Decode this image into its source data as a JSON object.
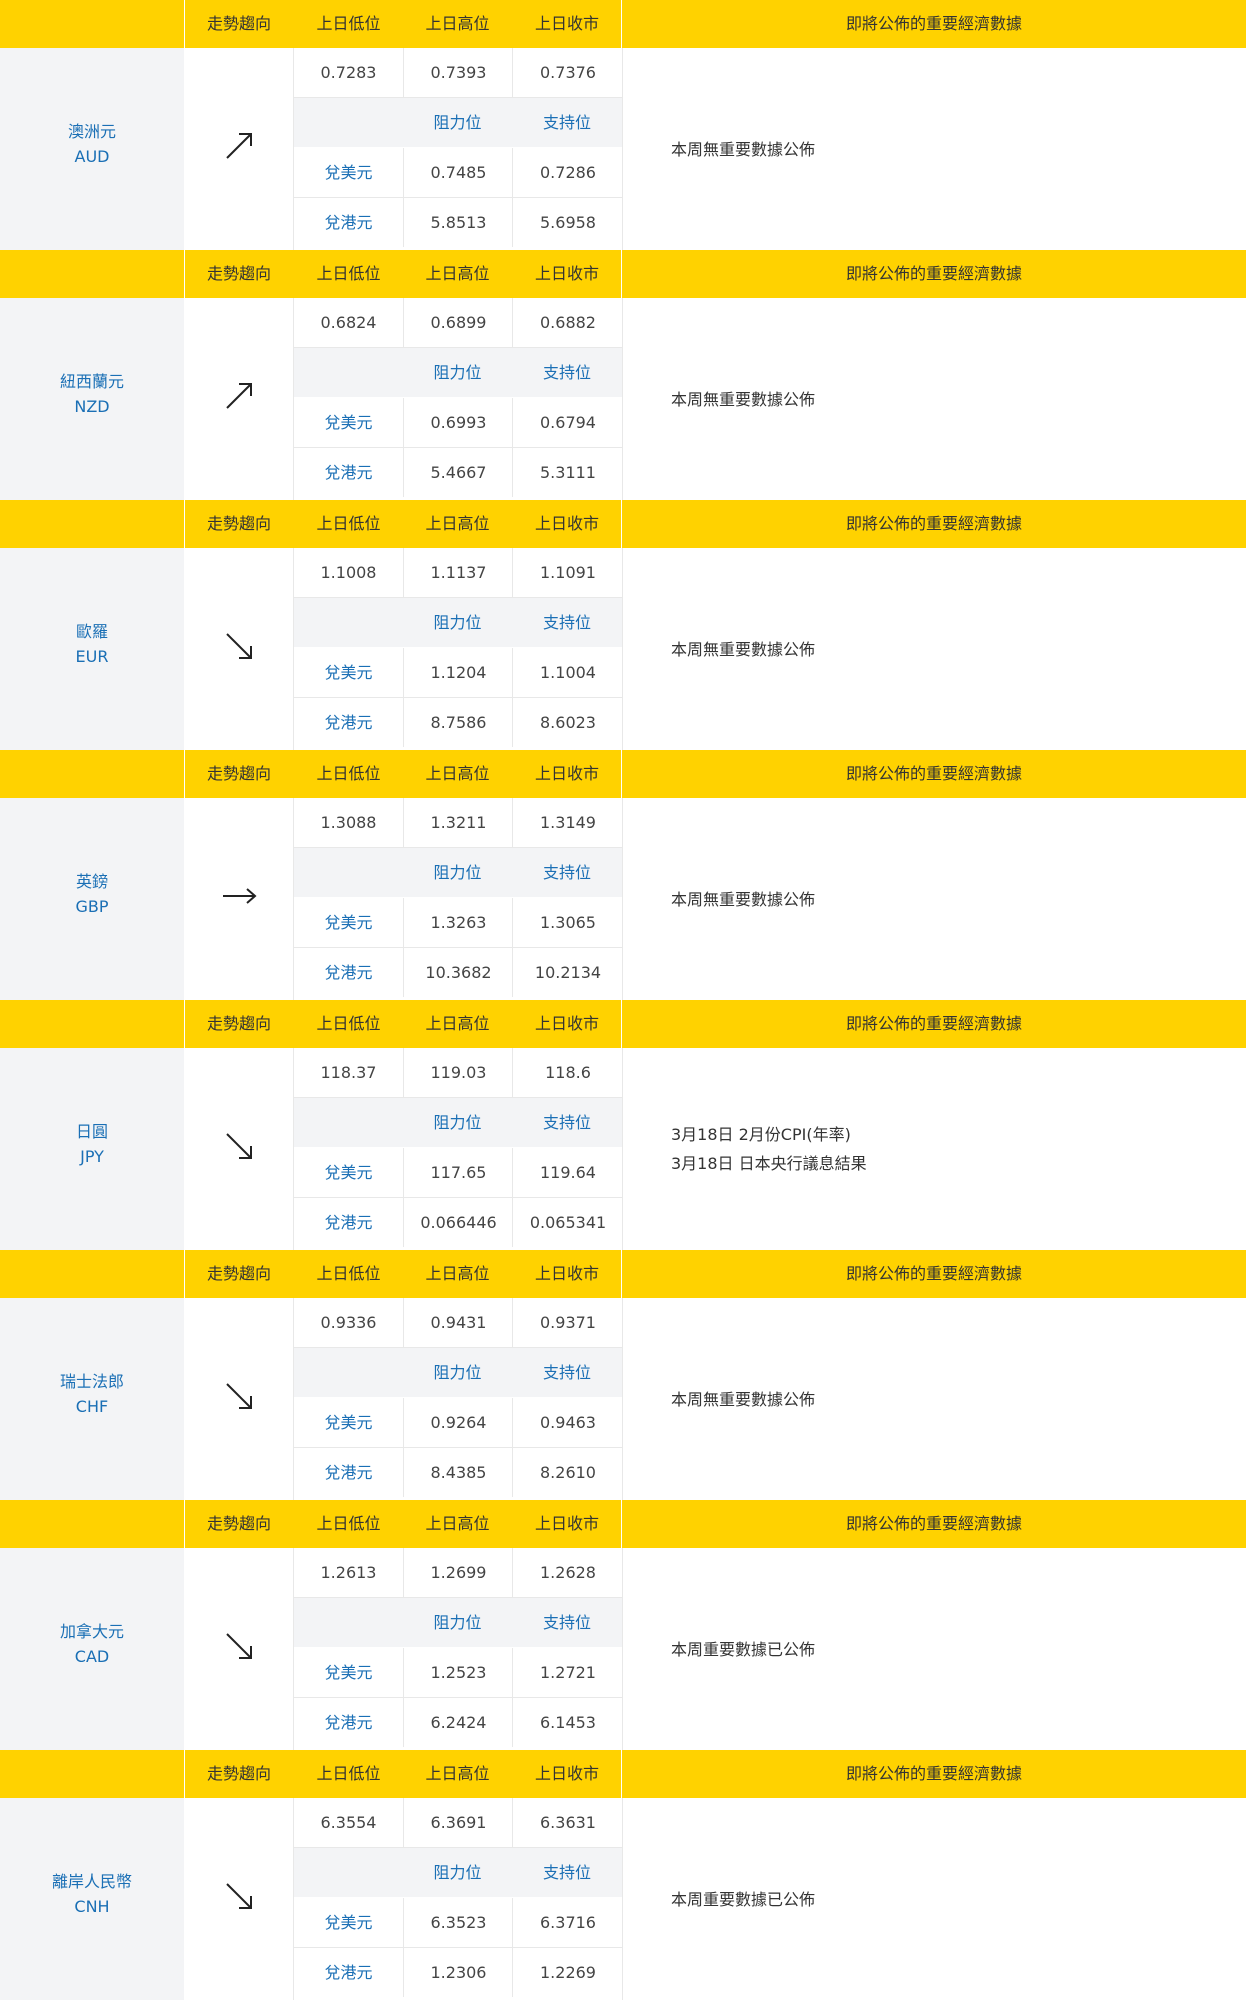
{
  "header": {
    "trend": "走勢趨向",
    "prev_low": "上日低位",
    "prev_high": "上日高位",
    "prev_close": "上日收市",
    "resistance": "阻力位",
    "support": "支持位",
    "to_usd": "兌美元",
    "to_hkd": "兌港元",
    "events_title": "即將公佈的重要經濟數據"
  },
  "currencies": [
    {
      "name": "澳洲元",
      "code": "AUD",
      "trend": "up",
      "low": "0.7283",
      "high": "0.7393",
      "close": "0.7376",
      "usd_res": "0.7485",
      "usd_sup": "0.7286",
      "hkd_res": "5.8513",
      "hkd_sup": "5.6958",
      "events": [
        "本周無重要數據公佈"
      ]
    },
    {
      "name": "紐西蘭元",
      "code": "NZD",
      "trend": "up",
      "low": "0.6824",
      "high": "0.6899",
      "close": "0.6882",
      "usd_res": "0.6993",
      "usd_sup": "0.6794",
      "hkd_res": "5.4667",
      "hkd_sup": "5.3111",
      "events": [
        "本周無重要數據公佈"
      ]
    },
    {
      "name": "歐羅",
      "code": "EUR",
      "trend": "down",
      "low": "1.1008",
      "high": "1.1137",
      "close": "1.1091",
      "usd_res": "1.1204",
      "usd_sup": "1.1004",
      "hkd_res": "8.7586",
      "hkd_sup": "8.6023",
      "events": [
        "本周無重要數據公佈"
      ]
    },
    {
      "name": "英鎊",
      "code": "GBP",
      "trend": "flat",
      "low": "1.3088",
      "high": "1.3211",
      "close": "1.3149",
      "usd_res": "1.3263",
      "usd_sup": "1.3065",
      "hkd_res": "10.3682",
      "hkd_sup": "10.2134",
      "events": [
        "本周無重要數據公佈"
      ]
    },
    {
      "name": "日圓",
      "code": "JPY",
      "trend": "down",
      "low": "118.37",
      "high": "119.03",
      "close": "118.6",
      "usd_res": "117.65",
      "usd_sup": "119.64",
      "hkd_res": "0.066446",
      "hkd_sup": "0.065341",
      "events": [
        "3月18日 2月份CPI(年率)",
        "3月18日 日本央行議息結果"
      ]
    },
    {
      "name": "瑞士法郎",
      "code": "CHF",
      "trend": "down",
      "low": "0.9336",
      "high": "0.9431",
      "close": "0.9371",
      "usd_res": "0.9264",
      "usd_sup": "0.9463",
      "hkd_res": "8.4385",
      "hkd_sup": "8.2610",
      "events": [
        "本周無重要數據公佈"
      ]
    },
    {
      "name": "加拿大元",
      "code": "CAD",
      "trend": "down",
      "low": "1.2613",
      "high": "1.2699",
      "close": "1.2628",
      "usd_res": "1.2523",
      "usd_sup": "1.2721",
      "hkd_res": "6.2424",
      "hkd_sup": "6.1453",
      "events": [
        "本周重要數據已公佈"
      ]
    },
    {
      "name": "離岸人民幣",
      "code": "CNH",
      "trend": "down",
      "low": "6.3554",
      "high": "6.3691",
      "close": "6.3631",
      "usd_res": "6.3523",
      "usd_sup": "6.3716",
      "hkd_res": "1.2306",
      "hkd_sup": "1.2269",
      "events": [
        "本周重要數據已公佈"
      ]
    }
  ]
}
